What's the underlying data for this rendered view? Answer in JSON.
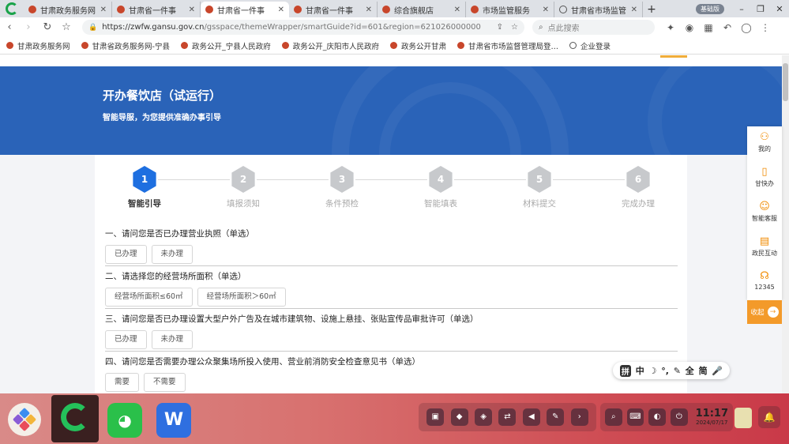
{
  "browser": {
    "tabs": [
      {
        "title": "甘肃政务服务网",
        "active": false
      },
      {
        "title": "甘肃省一件事",
        "active": false
      },
      {
        "title": "甘肃省一件事",
        "active": true
      },
      {
        "title": "甘肃省一件事",
        "active": false
      },
      {
        "title": "综合旗舰店",
        "active": false
      },
      {
        "title": "市场监管服务",
        "active": false
      },
      {
        "title": "甘肃省市场监管",
        "active": false
      }
    ],
    "badge": "基础版",
    "url_host": "https://zwfw.gansu.gov.cn",
    "url_path": "/gsspace/themeWrapper/smartGuide?id=601&region=621026000000",
    "search_placeholder": "点此搜索",
    "bookmarks": [
      "甘肃政务服务网",
      "甘肃省政务服务网-宁县",
      "政务公开_宁县人民政府",
      "政务公开_庆阳市人民政府",
      "政务公开甘肃",
      "甘肃省市场监督管理局登…",
      "企业登录"
    ]
  },
  "banner": {
    "title": "开办餐饮店（试运行）",
    "subtitle": "智能导服，为您提供准确办事引导"
  },
  "steps": [
    {
      "num": "1",
      "label": "智能引导",
      "active": true
    },
    {
      "num": "2",
      "label": "填报须知",
      "active": false
    },
    {
      "num": "3",
      "label": "条件预检",
      "active": false
    },
    {
      "num": "4",
      "label": "智能填表",
      "active": false
    },
    {
      "num": "5",
      "label": "材料提交",
      "active": false
    },
    {
      "num": "6",
      "label": "完成办理",
      "active": false
    }
  ],
  "questions": [
    {
      "text": "一、请问您是否已办理营业执照（单选）",
      "options": [
        "已办理",
        "未办理"
      ]
    },
    {
      "text": "二、请选择您的经营场所面积（单选）",
      "options": [
        "经营场所面积≤60㎡",
        "经营场所面积＞60㎡"
      ]
    },
    {
      "text": "三、请问您是否已办理设置大型户外广告及在城市建筑物、设施上悬挂、张贴宣传品审批许可（单选）",
      "options": [
        "已办理",
        "未办理"
      ]
    },
    {
      "text": "四、请问您是否需要办理公众聚集场所投入使用、营业前消防安全检查意见书（单选）",
      "options": [
        "需要",
        "不需要"
      ]
    }
  ],
  "float_menu": [
    {
      "label": "我的",
      "icon": "user-icon"
    },
    {
      "label": "甘快办",
      "icon": "phone-icon"
    },
    {
      "label": "智能客服",
      "icon": "avatar-icon"
    },
    {
      "label": "政民互动",
      "icon": "chat-icon"
    },
    {
      "label": "12345",
      "icon": "headset-icon"
    }
  ],
  "collapse_label": "收起",
  "ime": {
    "items": [
      "拼",
      "中",
      "☽",
      "°,",
      "✎",
      "全",
      "简",
      "🎤"
    ]
  },
  "taskbar": {
    "time": "11:17",
    "date": "2024/07/17"
  }
}
